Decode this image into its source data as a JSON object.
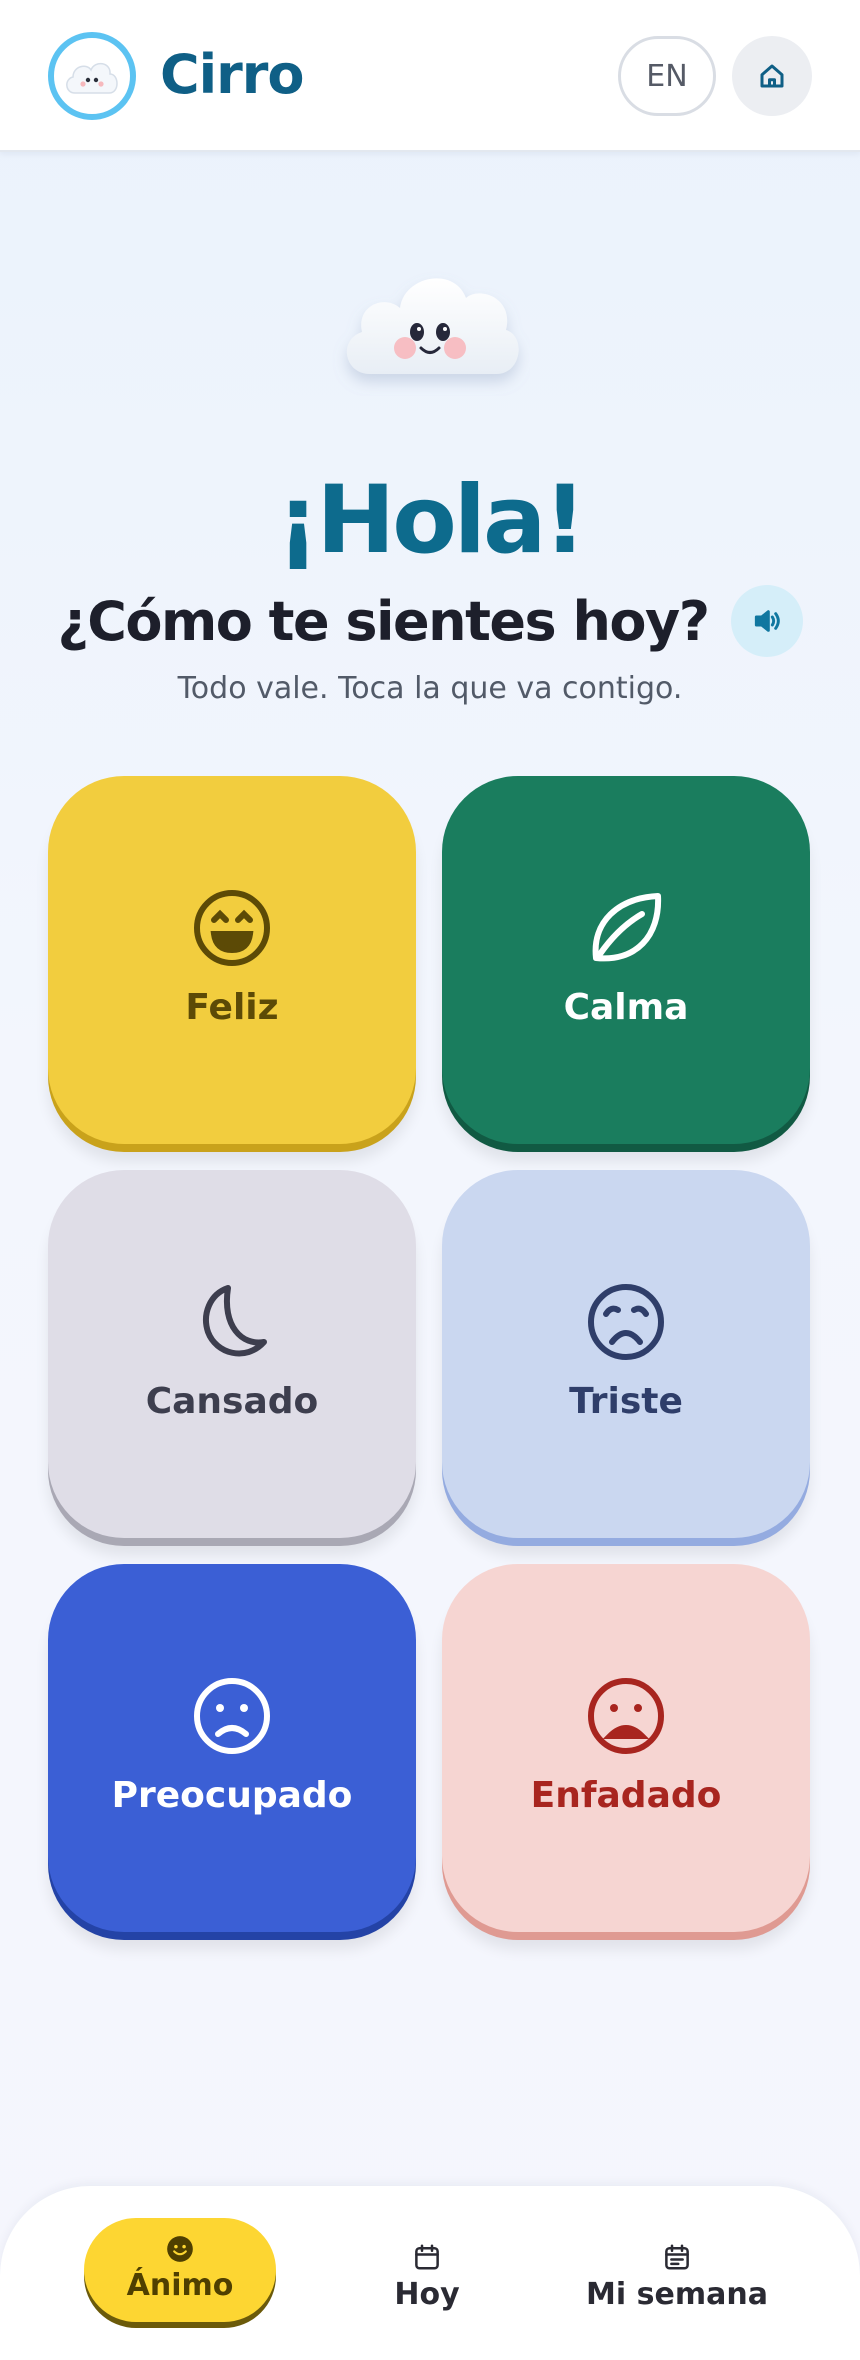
{
  "header": {
    "brand": "Cirro",
    "lang_button": "EN",
    "home_icon": "home-icon",
    "logo_icon": "cloud-mascot-icon"
  },
  "greeting": {
    "title": "¡Hola!",
    "question": "¿Cómo te sientes hoy?",
    "subtitle": "Todo vale. Toca la que va contigo.",
    "speaker_icon": "speaker-icon"
  },
  "moods": [
    {
      "label": "Feliz",
      "icon": "happy-face-icon",
      "color": "#f2cd3e",
      "text_color": "#5c4a06"
    },
    {
      "label": "Calma",
      "icon": "leaf-icon",
      "color": "#1a7d5e",
      "text_color": "#ffffff"
    },
    {
      "label": "Cansado",
      "icon": "moon-icon",
      "color": "#dfdde7",
      "text_color": "#3d3e4e"
    },
    {
      "label": "Triste",
      "icon": "sad-face-icon",
      "color": "#cad7f0",
      "text_color": "#2f3e6a"
    },
    {
      "label": "Preocupado",
      "icon": "worried-face-icon",
      "color": "#3b5fd5",
      "text_color": "#ffffff"
    },
    {
      "label": "Enfadado",
      "icon": "angry-face-icon",
      "color": "#f6d5d2",
      "text_color": "#a8251f"
    }
  ],
  "nav": {
    "items": [
      {
        "label": "Ánimo",
        "icon": "smiley-icon",
        "active": true
      },
      {
        "label": "Hoy",
        "icon": "calendar-icon",
        "active": false
      },
      {
        "label": "Mi semana",
        "icon": "calendar-week-icon",
        "active": false
      }
    ]
  },
  "colors": {
    "brand": "#0f5f86",
    "logo_ring": "#5cc3f2",
    "active_nav": "#fdd632"
  }
}
